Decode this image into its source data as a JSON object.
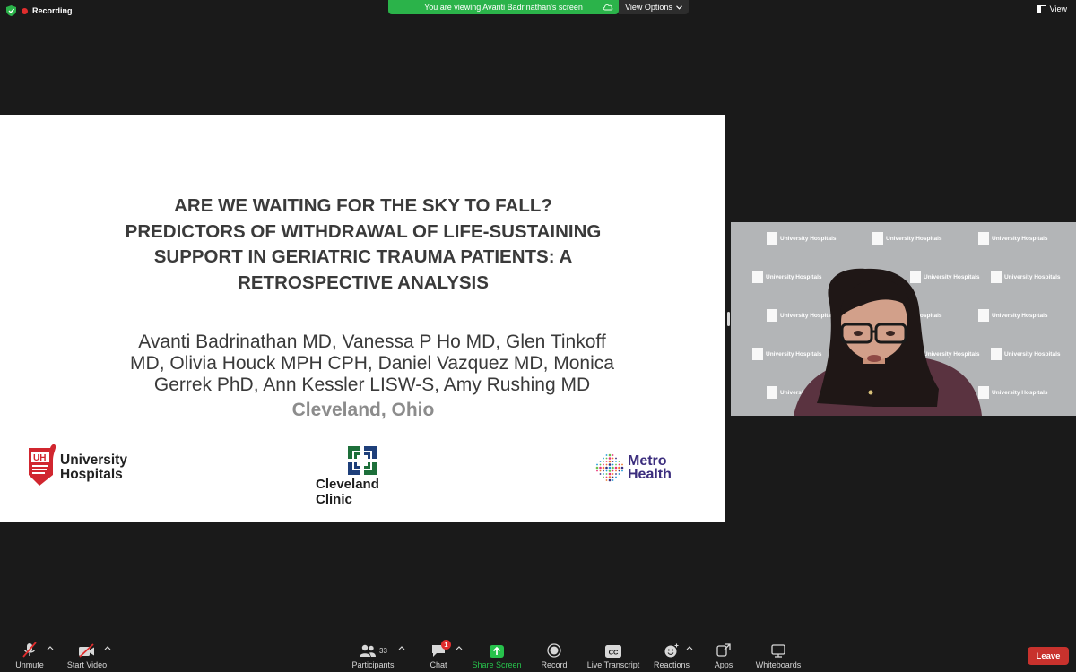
{
  "topbar": {
    "recording_label": "Recording",
    "banner_text": "You are viewing Avanti Badrinathan's screen",
    "view_options_label": "View Options",
    "view_label": "View"
  },
  "slide": {
    "title_lines": [
      "ARE WE WAITING FOR THE SKY TO FALL?",
      "PREDICTORS OF WITHDRAWAL OF LIFE-SUSTAINING",
      "SUPPORT IN GERIATRIC TRAUMA PATIENTS: A",
      "RETROSPECTIVE ANALYSIS"
    ],
    "author_lines": [
      "Avanti Badrinathan MD, Vanessa P Ho MD, Glen Tinkoff",
      "MD, Olivia Houck MPH CPH, Daniel Vazquez MD, Monica",
      "Gerrek PhD, Ann Kessler LISW-S, Amy Rushing MD"
    ],
    "location": "Cleveland, Ohio",
    "logos": {
      "uh_mark": "UH",
      "uh_line1": "University",
      "uh_line2": "Hospitals",
      "cc_name": "Cleveland Clinic",
      "mh_line1": "Metro",
      "mh_line2": "Health"
    }
  },
  "video": {
    "backdrop_brand": "University Hospitals"
  },
  "toolbar": {
    "unmute_label": "Unmute",
    "start_video_label": "Start Video",
    "participants_label": "Participants",
    "participants_count": "33",
    "chat_label": "Chat",
    "chat_badge": "1",
    "share_screen_label": "Share Screen",
    "record_label": "Record",
    "live_transcript_label": "Live Transcript",
    "cc_icon_text": "CC",
    "reactions_label": "Reactions",
    "apps_label": "Apps",
    "whiteboards_label": "Whiteboards",
    "leave_label": "Leave"
  },
  "colors": {
    "banner_green": "#2bb34a",
    "share_green": "#27c24c",
    "leave_red": "#c8322d",
    "recording_red": "#e02d2d",
    "metrohealth_purple": "#3b2d7d",
    "uh_red": "#d1262f"
  }
}
